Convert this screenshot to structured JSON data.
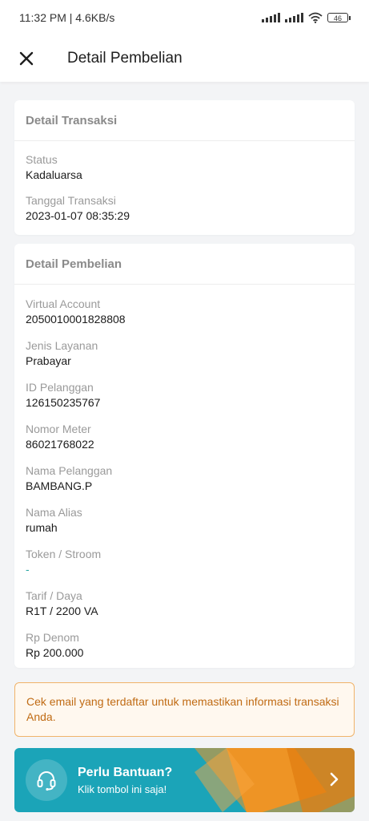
{
  "status_bar": {
    "time_speed": "11:32 PM | 4.6KB/s",
    "battery": "46"
  },
  "header": {
    "title": "Detail Pembelian"
  },
  "transaction_card": {
    "title": "Detail Transaksi",
    "fields": [
      {
        "label": "Status",
        "value": "Kadaluarsa"
      },
      {
        "label": "Tanggal Transaksi",
        "value": "2023-01-07 08:35:29"
      }
    ]
  },
  "purchase_card": {
    "title": "Detail Pembelian",
    "fields": [
      {
        "label": "Virtual Account",
        "value": "2050010001828808"
      },
      {
        "label": "Jenis Layanan",
        "value": "Prabayar"
      },
      {
        "label": "ID Pelanggan",
        "value": "126150235767"
      },
      {
        "label": "Nomor Meter",
        "value": "86021768022"
      },
      {
        "label": "Nama Pelanggan",
        "value": "BAMBANG.P"
      },
      {
        "label": "Nama Alias",
        "value": "rumah"
      },
      {
        "label": "Token / Stroom",
        "value": "-"
      },
      {
        "label": "Tarif / Daya",
        "value": "R1T / 2200 VA"
      },
      {
        "label": "Rp Denom",
        "value": "Rp 200.000"
      }
    ]
  },
  "notice": {
    "text": "Cek email yang terdaftar untuk memastikan informasi transaksi Anda."
  },
  "help_banner": {
    "title": "Perlu Bantuan?",
    "subtitle": "Klik tombol ini saja!",
    "icon": "headset-icon"
  },
  "colors": {
    "accent_teal": "#1ba4b8",
    "accent_orange": "#f7931e",
    "notice_border": "#f0b36a",
    "notice_text": "#c06b14"
  }
}
